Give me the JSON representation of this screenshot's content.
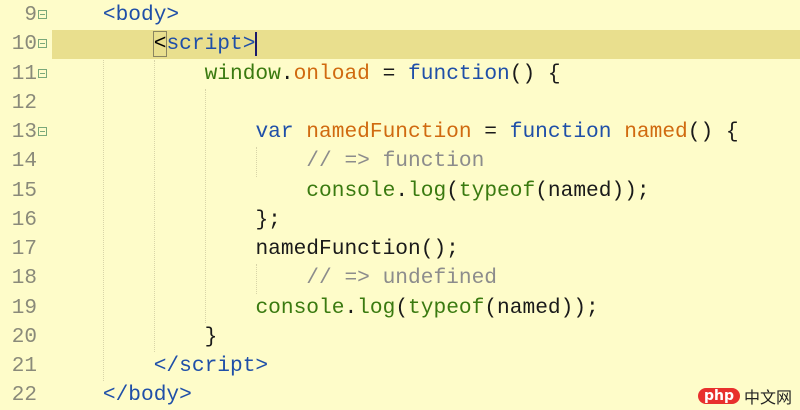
{
  "editor": {
    "current_line": 10,
    "lines": [
      {
        "num": "9",
        "fold": true,
        "indent": 4,
        "tokens": [
          [
            "<body>",
            "tag"
          ]
        ]
      },
      {
        "num": "10",
        "fold": true,
        "indent": 8,
        "tokens": [
          [
            "<",
            "cur"
          ],
          [
            "script>",
            "tag"
          ]
        ],
        "caret": true
      },
      {
        "num": "11",
        "fold": true,
        "indent": 12,
        "tokens": [
          [
            "window",
            "obj"
          ],
          [
            ".",
            "pun"
          ],
          [
            "onload",
            "prop"
          ],
          [
            " = ",
            "pun"
          ],
          [
            "function",
            "kw"
          ],
          [
            "() {",
            "pun"
          ]
        ]
      },
      {
        "num": "12",
        "fold": false,
        "indent": 0,
        "tokens": []
      },
      {
        "num": "13",
        "fold": true,
        "indent": 16,
        "tokens": [
          [
            "var ",
            "kw"
          ],
          [
            "namedFunction",
            "prop"
          ],
          [
            " = ",
            "pun"
          ],
          [
            "function ",
            "kw"
          ],
          [
            "named",
            "prop"
          ],
          [
            "() {",
            "pun"
          ]
        ]
      },
      {
        "num": "14",
        "fold": false,
        "indent": 20,
        "tokens": [
          [
            "// => function",
            "cmt"
          ]
        ]
      },
      {
        "num": "15",
        "fold": false,
        "indent": 20,
        "tokens": [
          [
            "console",
            "obj"
          ],
          [
            ".",
            "pun"
          ],
          [
            "log",
            "fn"
          ],
          [
            "(",
            "pun"
          ],
          [
            "typeof",
            "fn"
          ],
          [
            "(named));",
            "pun"
          ]
        ]
      },
      {
        "num": "16",
        "fold": false,
        "indent": 16,
        "tokens": [
          [
            "};",
            "pun"
          ]
        ]
      },
      {
        "num": "17",
        "fold": false,
        "indent": 16,
        "tokens": [
          [
            "namedFunction();",
            "pun"
          ]
        ]
      },
      {
        "num": "18",
        "fold": false,
        "indent": 20,
        "tokens": [
          [
            "// => undefined",
            "cmt"
          ]
        ]
      },
      {
        "num": "19",
        "fold": false,
        "indent": 16,
        "tokens": [
          [
            "console",
            "obj"
          ],
          [
            ".",
            "pun"
          ],
          [
            "log",
            "fn"
          ],
          [
            "(",
            "pun"
          ],
          [
            "typeof",
            "fn"
          ],
          [
            "(named));",
            "pun"
          ]
        ]
      },
      {
        "num": "20",
        "fold": false,
        "indent": 12,
        "tokens": [
          [
            "}",
            "pun"
          ]
        ]
      },
      {
        "num": "21",
        "fold": false,
        "indent": 8,
        "tokens": [
          [
            "</script>",
            "tag"
          ]
        ]
      },
      {
        "num": "22",
        "fold": false,
        "indent": 4,
        "tokens": [
          [
            "</body>",
            "tag"
          ]
        ]
      }
    ]
  },
  "watermark": {
    "badge": "php",
    "text": "中文网"
  }
}
